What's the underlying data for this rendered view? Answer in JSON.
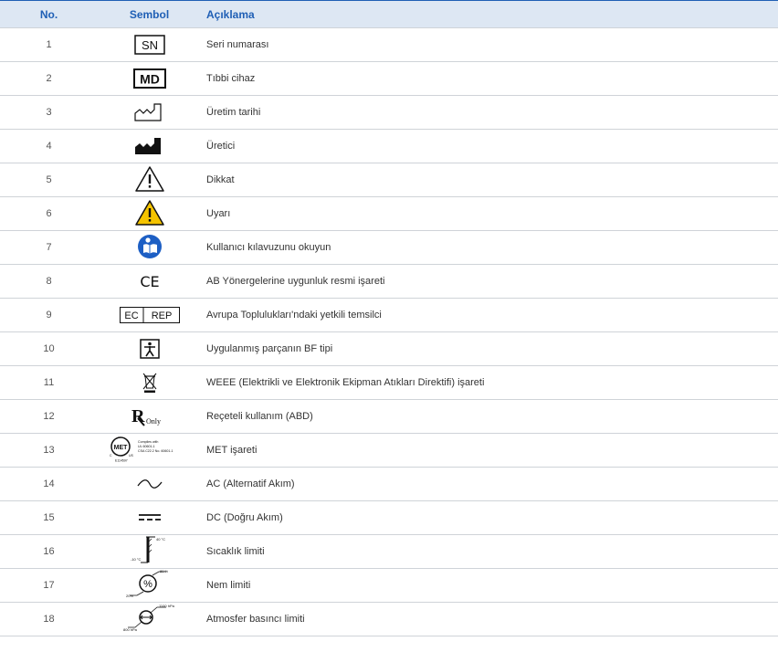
{
  "header": {
    "no": "No.",
    "symbol": "Sembol",
    "description": "Açıklama"
  },
  "rows": [
    {
      "no": "1",
      "desc": "Seri numarası",
      "icon": "serial-number-icon",
      "text": "SN"
    },
    {
      "no": "2",
      "desc": "Tıbbi cihaz",
      "icon": "medical-device-icon",
      "text": "MD"
    },
    {
      "no": "3",
      "desc": "Üretim tarihi",
      "icon": "date-of-manufacture-icon"
    },
    {
      "no": "4",
      "desc": "Üretici",
      "icon": "manufacturer-icon"
    },
    {
      "no": "5",
      "desc": "Dikkat",
      "icon": "caution-icon"
    },
    {
      "no": "6",
      "desc": "Uyarı",
      "icon": "warning-icon"
    },
    {
      "no": "7",
      "desc": "Kullanıcı kılavuzunu okuyun",
      "icon": "read-manual-icon"
    },
    {
      "no": "8",
      "desc": "AB Yönergelerine uygunluk resmi işareti",
      "icon": "ce-mark-icon",
      "text": "CE"
    },
    {
      "no": "9",
      "desc": "Avrupa Toplulukları'ndaki yetkili temsilci",
      "icon": "ec-rep-icon",
      "text_a": "EC",
      "text_b": "REP"
    },
    {
      "no": "10",
      "desc": "Uygulanmış parçanın BF tipi",
      "icon": "type-bf-icon"
    },
    {
      "no": "11",
      "desc": "WEEE (Elektrikli ve Elektronik Ekipman Atıkları Direktifi) işareti",
      "icon": "weee-icon"
    },
    {
      "no": "12",
      "desc": "Reçeteli kullanım (ABD)",
      "icon": "rx-only-icon",
      "text_a": "R",
      "text_b": "Only"
    },
    {
      "no": "13",
      "desc": "MET işareti",
      "icon": "met-mark-icon",
      "text_a": "MET",
      "text_b": "Complies with",
      "text_c": "UL 60601-1",
      "text_d": "CSA C22.2 No. 60601-1",
      "text_e": "E114597",
      "text_f": "C",
      "text_g": "US"
    },
    {
      "no": "14",
      "desc": "AC (Alternatif Akım)",
      "icon": "ac-icon"
    },
    {
      "no": "15",
      "desc": "DC (Doğru Akım)",
      "icon": "dc-icon"
    },
    {
      "no": "16",
      "desc": "Sıcaklık limiti",
      "icon": "temperature-limit-icon",
      "text_a": "40 °C",
      "text_b": "-10 °C"
    },
    {
      "no": "17",
      "desc": "Nem limiti",
      "icon": "humidity-limit-icon",
      "text_a": "%",
      "text_b": "80 %",
      "text_c": "20%"
    },
    {
      "no": "18",
      "desc": "Atmosfer basıncı limiti",
      "icon": "pressure-limit-icon",
      "text_a": "1100 hPa",
      "text_b": "800 hPa"
    }
  ]
}
